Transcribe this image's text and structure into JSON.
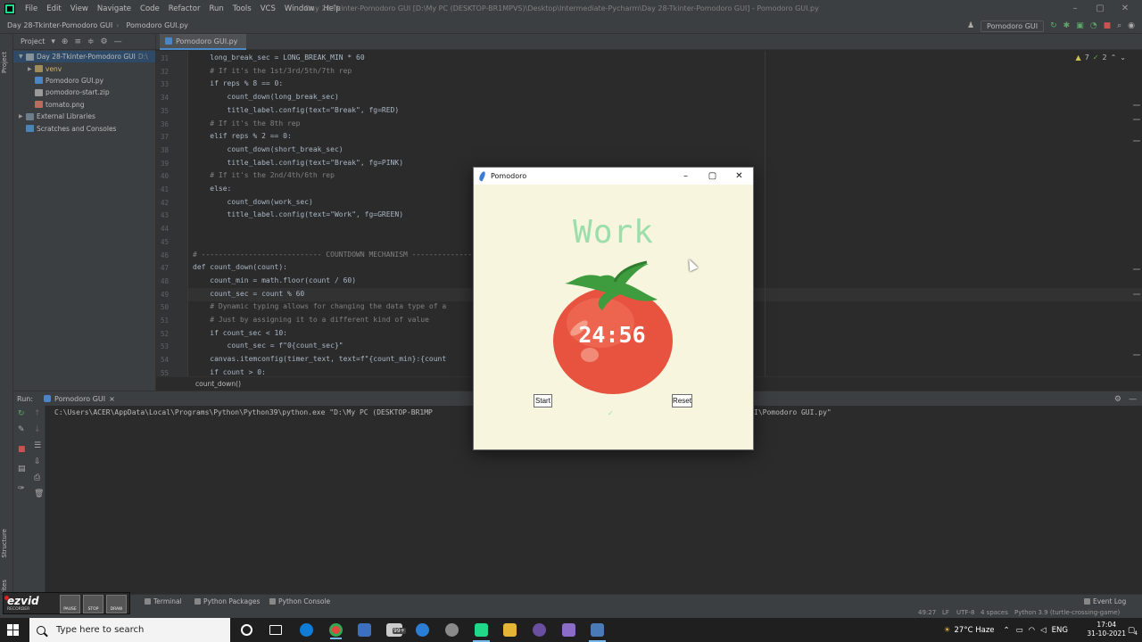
{
  "ide": {
    "menu": [
      "File",
      "Edit",
      "View",
      "Navigate",
      "Code",
      "Refactor",
      "Run",
      "Tools",
      "VCS",
      "Window",
      "Help"
    ],
    "window_title": "Day 28-Tkinter-Pomodoro GUI [D:\\My PC (DESKTOP-BR1MPVS)\\Desktop\\Intermediate-Pycharm\\Day 28-Tkinter-Pomodoro GUI] - Pomodoro GUI.py",
    "breadcrumb_project": "Day 28-Tkinter-Pomodoro GUI",
    "breadcrumb_file": "Pomodoro GUI.py",
    "run_config": "Pomodoro GUI",
    "accent_color": "#4a88c7"
  },
  "project_panel": {
    "header": "Project",
    "items": [
      {
        "label": "Day 28-Tkinter-Pomodoro GUI",
        "suffix": "D:\\"
      },
      {
        "label": "venv"
      },
      {
        "label": "Pomodoro GUI.py"
      },
      {
        "label": "pomodoro-start.zip"
      },
      {
        "label": "tomato.png"
      },
      {
        "label": "External Libraries"
      },
      {
        "label": "Scratches and Consoles"
      }
    ]
  },
  "editor": {
    "tab_label": "Pomodoro GUI.py",
    "status_warnings": "7",
    "status_typos": "2",
    "breadcrumb": "count_down()",
    "lines": [
      {
        "n": "31",
        "text": "    long_break_sec = LONG_BREAK_MIN * 60",
        "cls": ""
      },
      {
        "n": "32",
        "text": "    # If it's the 1st/3rd/5th/7th rep",
        "cls": "cm"
      },
      {
        "n": "33",
        "text": "    if reps % 8 == 0:",
        "cls": ""
      },
      {
        "n": "34",
        "text": "        count_down(long_break_sec)",
        "cls": ""
      },
      {
        "n": "35",
        "text": "        title_label.config(text=\"Break\", fg=RED)",
        "cls": ""
      },
      {
        "n": "36",
        "text": "    # If it's the 8th rep",
        "cls": "cm"
      },
      {
        "n": "37",
        "text": "    elif reps % 2 == 0:",
        "cls": ""
      },
      {
        "n": "38",
        "text": "        count_down(short_break_sec)",
        "cls": ""
      },
      {
        "n": "39",
        "text": "        title_label.config(text=\"Break\", fg=PINK)",
        "cls": ""
      },
      {
        "n": "40",
        "text": "    # If it's the 2nd/4th/6th rep",
        "cls": "cm"
      },
      {
        "n": "41",
        "text": "    else:",
        "cls": ""
      },
      {
        "n": "42",
        "text": "        count_down(work_sec)",
        "cls": ""
      },
      {
        "n": "43",
        "text": "        title_label.config(text=\"Work\", fg=GREEN)",
        "cls": ""
      },
      {
        "n": "44",
        "text": "",
        "cls": ""
      },
      {
        "n": "45",
        "text": "",
        "cls": ""
      },
      {
        "n": "46",
        "text": "# ---------------------------- COUNTDOWN MECHANISM -------------------------------",
        "cls": "cm"
      },
      {
        "n": "47",
        "text": "def count_down(count):",
        "cls": ""
      },
      {
        "n": "48",
        "text": "    count_min = math.floor(count / 60)",
        "cls": ""
      },
      {
        "n": "49",
        "text": "    count_sec = count % 60",
        "cls": ""
      },
      {
        "n": "50",
        "text": "    # Dynamic typing allows for changing the data type of a",
        "cls": "cm"
      },
      {
        "n": "51",
        "text": "    # Just by assigning it to a different kind of value",
        "cls": "cm"
      },
      {
        "n": "52",
        "text": "    if count_sec < 10:",
        "cls": ""
      },
      {
        "n": "53",
        "text": "        count_sec = f\"0{count_sec}\"",
        "cls": ""
      },
      {
        "n": "54",
        "text": "    canvas.itemconfig(timer_text, text=f\"{count_min}:{count",
        "cls": ""
      },
      {
        "n": "55",
        "text": "    if count > 0:",
        "cls": ""
      }
    ]
  },
  "run_panel": {
    "label": "Run:",
    "tab": "Pomodoro GUI",
    "command": "C:\\Users\\ACER\\AppData\\Local\\Programs\\Python\\Python39\\python.exe \"D:\\My PC (DESKTOP-BR1MP",
    "command_tail": "I\\Pomodoro GUI.py\""
  },
  "bottom_tools": {
    "terminal": "Terminal",
    "packages": "Python Packages",
    "console": "Python Console",
    "event_log": "Event Log"
  },
  "status_bar": {
    "position": "49:27",
    "line_sep": "LF",
    "encoding": "UTF-8",
    "indent": "4 spaces",
    "interpreter": "Python 3.9 (turtle-crossing-game)"
  },
  "side_tabs": {
    "project": "Project",
    "structure": "Structure",
    "favorites": "Favorites"
  },
  "ezvid": {
    "logo": "ezvid",
    "sub": "RECORDER",
    "buttons": [
      "PAUSE",
      "STOP",
      "DRAW"
    ]
  },
  "pomodoro": {
    "window_title": "Pomodoro",
    "label": "Work",
    "timer": "24:56",
    "start_button": "Start",
    "reset_button": "Reset",
    "check_marks": "✓",
    "label_color": "#9bdeac",
    "bg_color": "#f7f5dd"
  },
  "taskbar": {
    "search_placeholder": "Type here to search",
    "weather": "27°C  Haze",
    "language": "ENG",
    "time": "17:04",
    "date": "31-10-2021",
    "mail_badge": "99+",
    "notification_count": "4"
  }
}
